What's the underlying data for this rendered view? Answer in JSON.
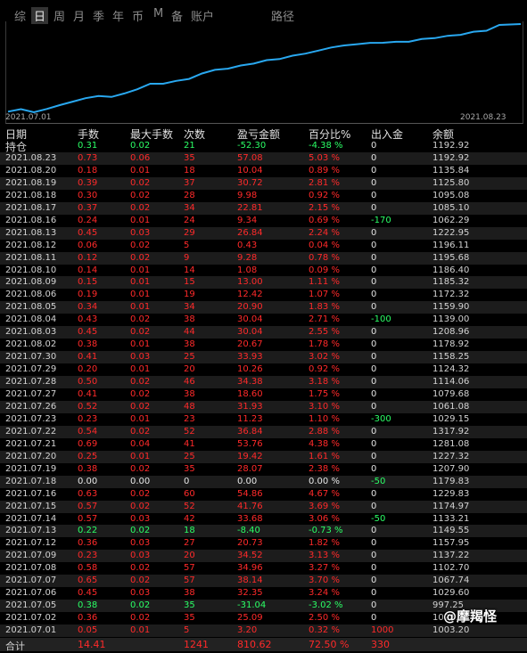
{
  "tabs": [
    "综",
    "日",
    "周",
    "月",
    "季",
    "年",
    "币",
    "M",
    "备",
    "账户",
    "路径"
  ],
  "active_tab": "日",
  "chart": {
    "start_date": "2021.07.01",
    "end_date": "2021.08.23",
    "line_color": "#29a8f0"
  },
  "columns": {
    "date": "日期",
    "hands": "手数",
    "max_hands": "最大手数",
    "count": "次数",
    "pnl": "盈亏金额",
    "pct": "百分比%",
    "flow": "出入金",
    "balance": "余额"
  },
  "rows": [
    {
      "date": "持仓",
      "hands": "0.31",
      "max_hands": "0.02",
      "count": "21",
      "pnl": "-52.30",
      "pct": "-4.38 %",
      "flow": "0",
      "balance": "1192.92"
    },
    {
      "date": "2021.08.23",
      "hands": "0.73",
      "max_hands": "0.06",
      "count": "35",
      "pnl": "57.08",
      "pct": "5.03 %",
      "flow": "0",
      "balance": "1192.92"
    },
    {
      "date": "2021.08.20",
      "hands": "0.18",
      "max_hands": "0.01",
      "count": "18",
      "pnl": "10.04",
      "pct": "0.89 %",
      "flow": "0",
      "balance": "1135.84"
    },
    {
      "date": "2021.08.19",
      "hands": "0.39",
      "max_hands": "0.02",
      "count": "37",
      "pnl": "30.72",
      "pct": "2.81 %",
      "flow": "0",
      "balance": "1125.80"
    },
    {
      "date": "2021.08.18",
      "hands": "0.30",
      "max_hands": "0.02",
      "count": "28",
      "pnl": "9.98",
      "pct": "0.92 %",
      "flow": "0",
      "balance": "1095.08"
    },
    {
      "date": "2021.08.17",
      "hands": "0.37",
      "max_hands": "0.02",
      "count": "34",
      "pnl": "22.81",
      "pct": "2.15 %",
      "flow": "0",
      "balance": "1085.10"
    },
    {
      "date": "2021.08.16",
      "hands": "0.24",
      "max_hands": "0.01",
      "count": "24",
      "pnl": "9.34",
      "pct": "0.69 %",
      "flow": "-170",
      "balance": "1062.29"
    },
    {
      "date": "2021.08.13",
      "hands": "0.45",
      "max_hands": "0.03",
      "count": "29",
      "pnl": "26.84",
      "pct": "2.24 %",
      "flow": "0",
      "balance": "1222.95"
    },
    {
      "date": "2021.08.12",
      "hands": "0.06",
      "max_hands": "0.02",
      "count": "5",
      "pnl": "0.43",
      "pct": "0.04 %",
      "flow": "0",
      "balance": "1196.11"
    },
    {
      "date": "2021.08.11",
      "hands": "0.12",
      "max_hands": "0.02",
      "count": "9",
      "pnl": "9.28",
      "pct": "0.78 %",
      "flow": "0",
      "balance": "1195.68"
    },
    {
      "date": "2021.08.10",
      "hands": "0.14",
      "max_hands": "0.01",
      "count": "14",
      "pnl": "1.08",
      "pct": "0.09 %",
      "flow": "0",
      "balance": "1186.40"
    },
    {
      "date": "2021.08.09",
      "hands": "0.15",
      "max_hands": "0.01",
      "count": "15",
      "pnl": "13.00",
      "pct": "1.11 %",
      "flow": "0",
      "balance": "1185.32"
    },
    {
      "date": "2021.08.06",
      "hands": "0.19",
      "max_hands": "0.01",
      "count": "19",
      "pnl": "12.42",
      "pct": "1.07 %",
      "flow": "0",
      "balance": "1172.32"
    },
    {
      "date": "2021.08.05",
      "hands": "0.34",
      "max_hands": "0.01",
      "count": "34",
      "pnl": "20.90",
      "pct": "1.83 %",
      "flow": "0",
      "balance": "1159.90"
    },
    {
      "date": "2021.08.04",
      "hands": "0.43",
      "max_hands": "0.02",
      "count": "38",
      "pnl": "30.04",
      "pct": "2.71 %",
      "flow": "-100",
      "balance": "1139.00"
    },
    {
      "date": "2021.08.03",
      "hands": "0.45",
      "max_hands": "0.02",
      "count": "44",
      "pnl": "30.04",
      "pct": "2.55 %",
      "flow": "0",
      "balance": "1208.96"
    },
    {
      "date": "2021.08.02",
      "hands": "0.38",
      "max_hands": "0.01",
      "count": "38",
      "pnl": "20.67",
      "pct": "1.78 %",
      "flow": "0",
      "balance": "1178.92"
    },
    {
      "date": "2021.07.30",
      "hands": "0.41",
      "max_hands": "0.03",
      "count": "25",
      "pnl": "33.93",
      "pct": "3.02 %",
      "flow": "0",
      "balance": "1158.25"
    },
    {
      "date": "2021.07.29",
      "hands": "0.20",
      "max_hands": "0.01",
      "count": "20",
      "pnl": "10.26",
      "pct": "0.92 %",
      "flow": "0",
      "balance": "1124.32"
    },
    {
      "date": "2021.07.28",
      "hands": "0.50",
      "max_hands": "0.02",
      "count": "46",
      "pnl": "34.38",
      "pct": "3.18 %",
      "flow": "0",
      "balance": "1114.06"
    },
    {
      "date": "2021.07.27",
      "hands": "0.41",
      "max_hands": "0.02",
      "count": "38",
      "pnl": "18.60",
      "pct": "1.75 %",
      "flow": "0",
      "balance": "1079.68"
    },
    {
      "date": "2021.07.26",
      "hands": "0.52",
      "max_hands": "0.02",
      "count": "48",
      "pnl": "31.93",
      "pct": "3.10 %",
      "flow": "0",
      "balance": "1061.08"
    },
    {
      "date": "2021.07.23",
      "hands": "0.23",
      "max_hands": "0.01",
      "count": "23",
      "pnl": "11.23",
      "pct": "1.10 %",
      "flow": "-300",
      "balance": "1029.15"
    },
    {
      "date": "2021.07.22",
      "hands": "0.54",
      "max_hands": "0.02",
      "count": "52",
      "pnl": "36.84",
      "pct": "2.88 %",
      "flow": "0",
      "balance": "1317.92"
    },
    {
      "date": "2021.07.21",
      "hands": "0.69",
      "max_hands": "0.04",
      "count": "41",
      "pnl": "53.76",
      "pct": "4.38 %",
      "flow": "0",
      "balance": "1281.08"
    },
    {
      "date": "2021.07.20",
      "hands": "0.25",
      "max_hands": "0.01",
      "count": "25",
      "pnl": "19.42",
      "pct": "1.61 %",
      "flow": "0",
      "balance": "1227.32"
    },
    {
      "date": "2021.07.19",
      "hands": "0.38",
      "max_hands": "0.02",
      "count": "35",
      "pnl": "28.07",
      "pct": "2.38 %",
      "flow": "0",
      "balance": "1207.90"
    },
    {
      "date": "2021.07.18",
      "hands": "0.00",
      "max_hands": "0.00",
      "count": "0",
      "pnl": "0.00",
      "pct": "0.00 %",
      "flow": "-50",
      "balance": "1179.83"
    },
    {
      "date": "2021.07.16",
      "hands": "0.63",
      "max_hands": "0.02",
      "count": "60",
      "pnl": "54.86",
      "pct": "4.67 %",
      "flow": "0",
      "balance": "1229.83"
    },
    {
      "date": "2021.07.15",
      "hands": "0.57",
      "max_hands": "0.02",
      "count": "52",
      "pnl": "41.76",
      "pct": "3.69 %",
      "flow": "0",
      "balance": "1174.97"
    },
    {
      "date": "2021.07.14",
      "hands": "0.57",
      "max_hands": "0.03",
      "count": "42",
      "pnl": "33.68",
      "pct": "3.06 %",
      "flow": "-50",
      "balance": "1133.21"
    },
    {
      "date": "2021.07.13",
      "hands": "0.22",
      "max_hands": "0.02",
      "count": "18",
      "pnl": "-8.40",
      "pct": "-0.73 %",
      "flow": "0",
      "balance": "1149.55"
    },
    {
      "date": "2021.07.12",
      "hands": "0.36",
      "max_hands": "0.03",
      "count": "27",
      "pnl": "20.73",
      "pct": "1.82 %",
      "flow": "0",
      "balance": "1157.95"
    },
    {
      "date": "2021.07.09",
      "hands": "0.23",
      "max_hands": "0.03",
      "count": "20",
      "pnl": "34.52",
      "pct": "3.13 %",
      "flow": "0",
      "balance": "1137.22"
    },
    {
      "date": "2021.07.08",
      "hands": "0.58",
      "max_hands": "0.02",
      "count": "57",
      "pnl": "34.96",
      "pct": "3.27 %",
      "flow": "0",
      "balance": "1102.70"
    },
    {
      "date": "2021.07.07",
      "hands": "0.65",
      "max_hands": "0.02",
      "count": "57",
      "pnl": "38.14",
      "pct": "3.70 %",
      "flow": "0",
      "balance": "1067.74"
    },
    {
      "date": "2021.07.06",
      "hands": "0.45",
      "max_hands": "0.03",
      "count": "38",
      "pnl": "32.35",
      "pct": "3.24 %",
      "flow": "0",
      "balance": "1029.60"
    },
    {
      "date": "2021.07.05",
      "hands": "0.38",
      "max_hands": "0.02",
      "count": "35",
      "pnl": "-31.04",
      "pct": "-3.02 %",
      "flow": "0",
      "balance": "997.25"
    },
    {
      "date": "2021.07.02",
      "hands": "0.36",
      "max_hands": "0.02",
      "count": "35",
      "pnl": "25.09",
      "pct": "2.50 %",
      "flow": "0",
      "balance": "1028.29"
    },
    {
      "date": "2021.07.01",
      "hands": "0.05",
      "max_hands": "0.01",
      "count": "5",
      "pnl": "3.20",
      "pct": "0.32 %",
      "flow": "1000",
      "balance": "1003.20"
    }
  ],
  "total": {
    "label": "合计",
    "hands": "14.41",
    "count": "1241",
    "pnl": "810.62",
    "pct": "72.50 %",
    "flow": "330"
  },
  "watermark": "@摩羯怪",
  "colors": {
    "positive": "#ff2a2a",
    "negative": "#2bff66",
    "neutral": "#e6e6e6",
    "line": "#29a8f0"
  }
}
